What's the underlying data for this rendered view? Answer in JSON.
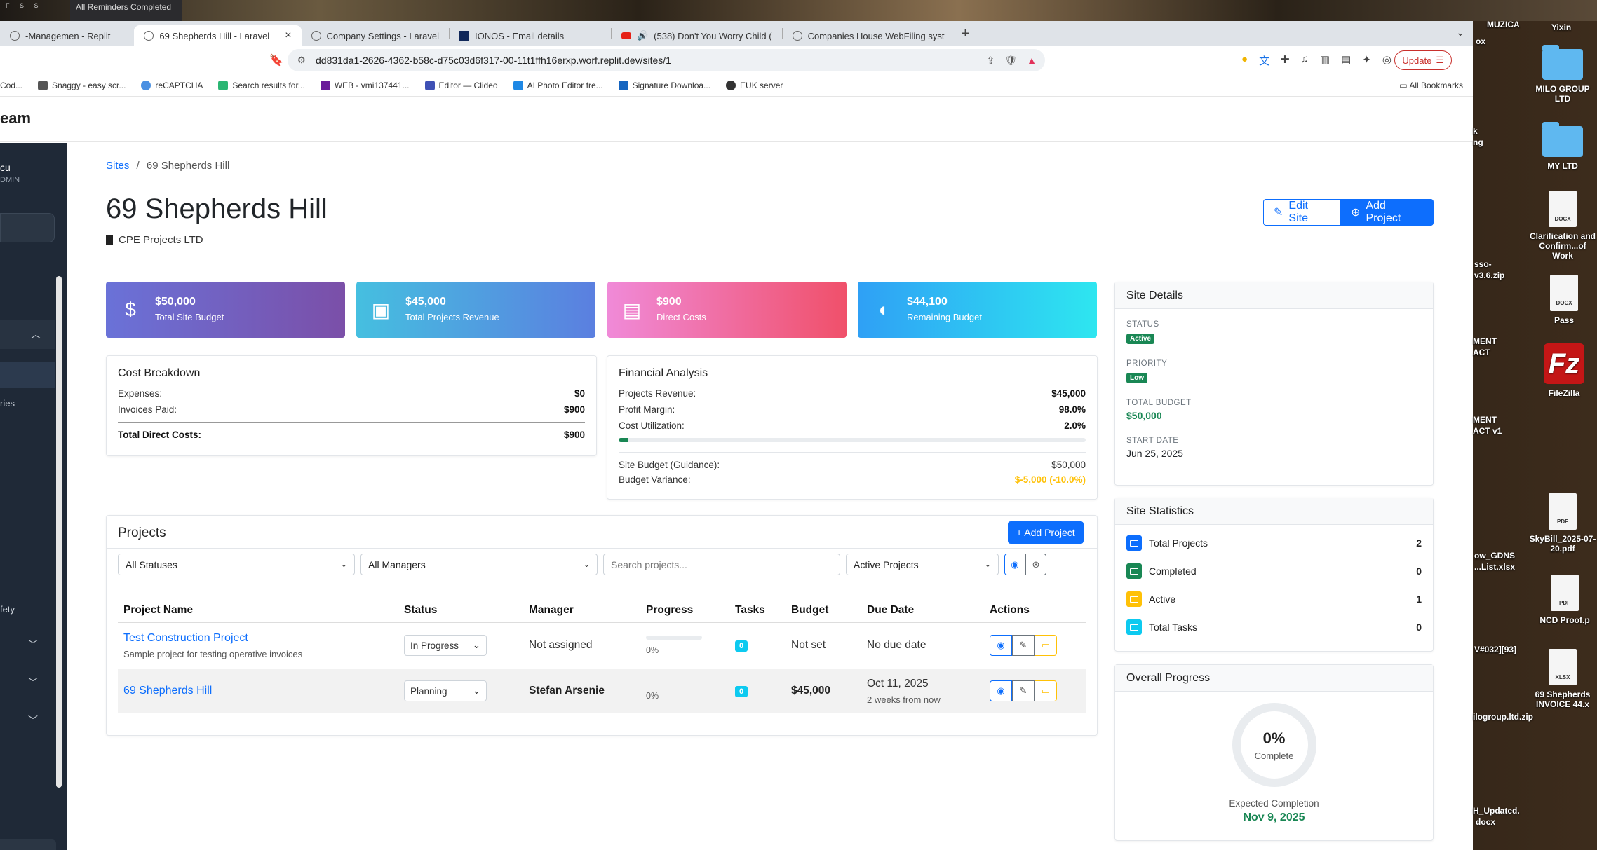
{
  "desktop": {
    "reminder": "All Reminders Completed",
    "keys": "F S S",
    "icons": [
      {
        "label": "MUZICA",
        "kind": "folder"
      },
      {
        "label": "Yixin",
        "kind": "folder"
      },
      {
        "label": "MILO GROUP LTD",
        "kind": "folder"
      },
      {
        "label": "MY LTD",
        "kind": "folder"
      },
      {
        "label": "Clarification and Confirm...of Work",
        "kind": "docx"
      },
      {
        "label": "Pass",
        "kind": "docx"
      },
      {
        "label": "FileZilla",
        "kind": "app"
      },
      {
        "label": "SkyBill_2025-07-20.pdf",
        "kind": "pdf"
      },
      {
        "label": "NCD Proof.p",
        "kind": "pdf"
      },
      {
        "label": "69 Shepherds INVOICE 44.x",
        "kind": "xlsx"
      }
    ],
    "partial_labels": [
      "ox",
      "k",
      "ng",
      "sso-",
      "v3.6.zip",
      "MENT",
      "ACT",
      "MENT",
      "ACT v1",
      "ow_GDNS",
      "...List.xlsx",
      "V#032][93]",
      "ilogroup.ltd.zip",
      "H_Updated.",
      "docx"
    ]
  },
  "browser": {
    "tabs": [
      {
        "label": "-Managemen - Replit",
        "icon": "replit-icon",
        "active": false
      },
      {
        "label": "69 Shepherds Hill - Laravel",
        "icon": "globe-icon",
        "active": true
      },
      {
        "label": "Company Settings - Laravel",
        "icon": "globe-icon",
        "active": false
      },
      {
        "label": "IONOS - Email details",
        "icon": "ionos-icon",
        "active": false
      },
      {
        "label": "(538) Don't You Worry Child (",
        "icon": "youtube-icon",
        "active": false
      },
      {
        "label": "Companies House WebFiling syst",
        "icon": "globe-icon",
        "active": false
      }
    ],
    "url": "dd831da1-2626-4362-b58c-d75c03d6f317-00-11t1ffh16erxp.worf.replit.dev/sites/1",
    "update_label": "Update",
    "bookmarks": [
      {
        "label": "Cod...",
        "color": "#888"
      },
      {
        "label": "Snaggy - easy scr...",
        "color": "#555"
      },
      {
        "label": "reCAPTCHA",
        "color": "#4a90e2"
      },
      {
        "label": "Search results for...",
        "color": "#2bb673"
      },
      {
        "label": "WEB - vmi137441...",
        "color": "#6a1b9a"
      },
      {
        "label": "Editor — Clideo",
        "color": "#3f51b5"
      },
      {
        "label": "AI Photo Editor fre...",
        "color": "#1e88e5"
      },
      {
        "label": "Signature Downloa...",
        "color": "#1565c0"
      },
      {
        "label": "EUK server",
        "color": "#333"
      }
    ],
    "all_bookmarks": "All Bookmarks"
  },
  "app": {
    "brand": "eam",
    "sidebar": {
      "user_name": "cu",
      "user_role": "DMIN",
      "item_ries": "ries",
      "item_fety": "fety"
    }
  },
  "page": {
    "breadcrumb_link": "Sites",
    "breadcrumb_sep": "/",
    "breadcrumb_current": "69 Shepherds Hill",
    "title": "69 Shepherds Hill",
    "company": "CPE Projects LTD",
    "edit_site": "Edit Site",
    "add_project": "Add Project"
  },
  "stats": [
    {
      "value": "$50,000",
      "label": "Total Site Budget",
      "icon": "dollar-icon",
      "gradient": "linear-gradient(90deg,#6a72d8,#7b4fa8)"
    },
    {
      "value": "$45,000",
      "label": "Total Projects Revenue",
      "icon": "cash-icon",
      "gradient": "linear-gradient(90deg,#45bfe0,#5b7fe0)"
    },
    {
      "value": "$900",
      "label": "Direct Costs",
      "icon": "receipt-icon",
      "gradient": "linear-gradient(90deg,#f08ad8,#f0506a)"
    },
    {
      "value": "$44,100",
      "label": "Remaining Budget",
      "icon": "piggy-bank-icon",
      "gradient": "linear-gradient(90deg,#2fa0f5,#2ee6f0)"
    }
  ],
  "cost_breakdown": {
    "title": "Cost Breakdown",
    "rows": [
      {
        "label": "Expenses:",
        "value": "$0"
      },
      {
        "label": "Invoices Paid:",
        "value": "$900"
      }
    ],
    "total_label": "Total Direct Costs:",
    "total_value": "$900"
  },
  "financial": {
    "title": "Financial Analysis",
    "projects_revenue_label": "Projects Revenue:",
    "projects_revenue": "$45,000",
    "profit_margin_label": "Profit Margin:",
    "profit_margin": "98.0%",
    "cost_util_label": "Cost Utilization:",
    "cost_util": "2.0%",
    "cost_util_fraction": 0.02,
    "site_budget_label": "Site Budget (Guidance):",
    "site_budget": "$50,000",
    "variance_label": "Budget Variance:",
    "variance": "$-5,000 (-10.0%)"
  },
  "site_details": {
    "title": "Site Details",
    "status_label": "STATUS",
    "status": "Active",
    "priority_label": "PRIORITY",
    "priority": "Low",
    "budget_label": "TOTAL BUDGET",
    "budget": "$50,000",
    "start_label": "START DATE",
    "start": "Jun 25, 2025"
  },
  "site_statistics": {
    "title": "Site Statistics",
    "rows": [
      {
        "label": "Total Projects",
        "value": "2",
        "color": "#0d6efd"
      },
      {
        "label": "Completed",
        "value": "0",
        "color": "#198754"
      },
      {
        "label": "Active",
        "value": "1",
        "color": "#ffc107"
      },
      {
        "label": "Total Tasks",
        "value": "0",
        "color": "#0dcaf0"
      }
    ]
  },
  "overall_progress": {
    "title": "Overall Progress",
    "percent": "0%",
    "percent_caption": "Complete",
    "expected_label": "Expected Completion",
    "expected": "Nov 9, 2025"
  },
  "projects": {
    "title": "Projects",
    "add_label": "+ Add Project",
    "filters": {
      "status": "All Statuses",
      "manager": "All Managers",
      "search_placeholder": "Search projects...",
      "scope": "Active Projects"
    },
    "columns": [
      "Project Name",
      "Status",
      "Manager",
      "Progress",
      "Tasks",
      "Budget",
      "Due Date",
      "Actions"
    ],
    "rows": [
      {
        "name": "Test Construction Project",
        "desc": "Sample project for testing operative invoices",
        "status": "In Progress",
        "manager": "Not assigned",
        "progress": "0%",
        "progress_fraction": 0,
        "tasks": "0",
        "budget": "Not set",
        "due": "No due date",
        "due_rel": ""
      },
      {
        "name": "69 Shepherds Hill",
        "desc": "",
        "status": "Planning",
        "manager": "Stefan Arsenie",
        "progress": "0%",
        "progress_fraction": 0,
        "tasks": "0",
        "budget": "$45,000",
        "due": "Oct 11, 2025",
        "due_rel": "2 weeks from now"
      }
    ]
  }
}
